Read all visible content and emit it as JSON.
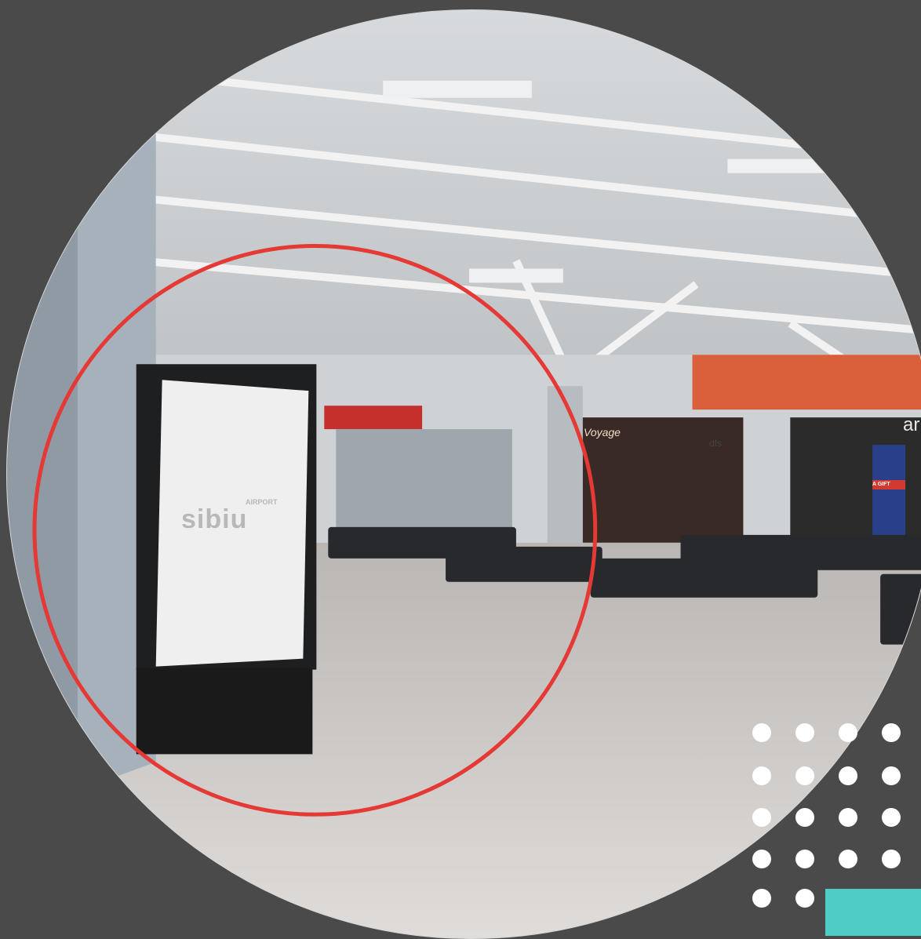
{
  "photo": {
    "display": {
      "logo_word": "sibiu",
      "logo_sub": "AIRPORT"
    },
    "store_signs": [
      "Voyage",
      "dfs",
      "ar"
    ],
    "gift_poster": "A GIFT"
  },
  "colors": {
    "background": "#4a4a4a",
    "highlight_ring": "#e53935",
    "accent": "#4ecdc4",
    "dots": "#ffffff"
  }
}
